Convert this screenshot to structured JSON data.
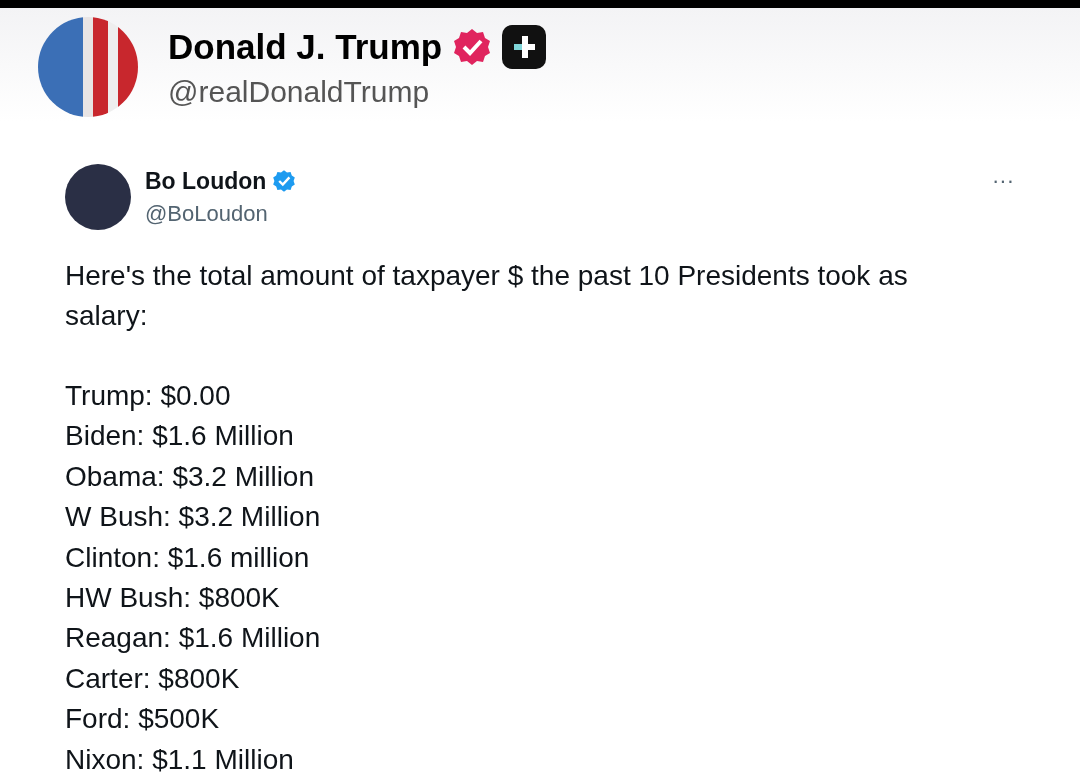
{
  "author": {
    "name": "Donald J. Trump",
    "handle": "@realDonaldTrump"
  },
  "quoted_post": {
    "author": {
      "name": "Bo Loudon",
      "handle": "@BoLoudon"
    },
    "more": "···",
    "intro": "Here's the total amount of taxpayer $ the past 10 Presidents took as salary:",
    "lines": [
      "Trump: $0.00",
      "Biden: $1.6 Million",
      "Obama: $3.2 Million",
      "W Bush: $3.2 Million",
      "Clinton: $1.6 million",
      "HW Bush: $800K",
      "Reagan: $1.6 Million",
      "Carter: $800K",
      "Ford: $500K",
      "Nixon: $1.1 Million"
    ]
  }
}
